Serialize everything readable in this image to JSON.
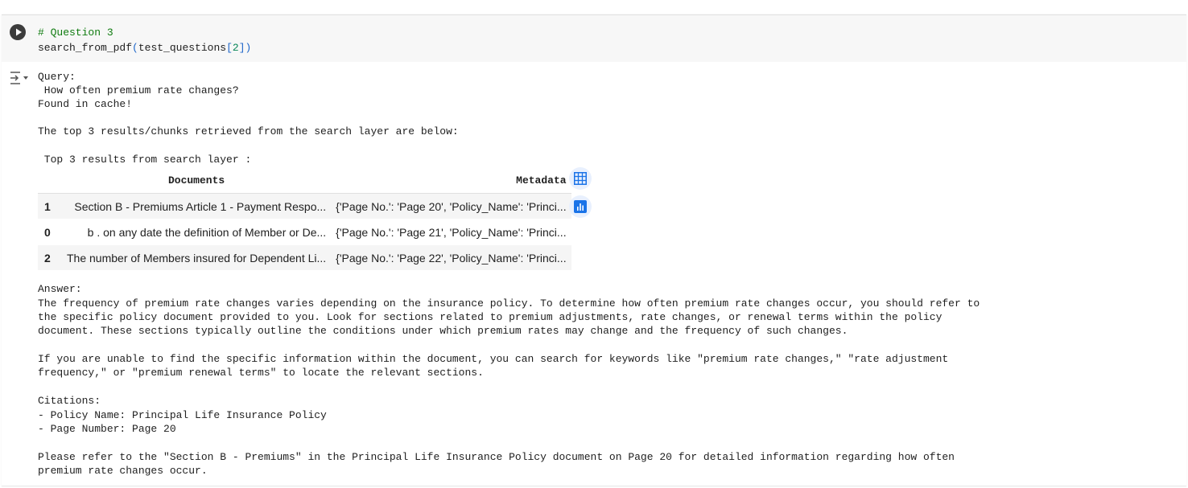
{
  "code_cell": {
    "comment": "# Question 3",
    "func": "search_from_pdf",
    "open_paren": "(",
    "arg_name": "test_questions",
    "open_bracket": "[",
    "index": "2",
    "close": "])"
  },
  "output": {
    "query_label": "Query:",
    "query_text": " How often premium rate changes?",
    "cache_text": "Found in cache!",
    "intro_text": "The top 3 results/chunks retrieved from the search layer are below:",
    "table_title": " Top 3 results from search layer :",
    "table": {
      "columns": [
        "Documents",
        "Metadata"
      ],
      "rows": [
        {
          "index": "1",
          "document": "Section B - Premiums Article 1 - Payment Respo...",
          "metadata": "{'Page No.': 'Page 20', 'Policy_Name': 'Princi..."
        },
        {
          "index": "0",
          "document": "b . on any date the definition of Member or De...",
          "metadata": "{'Page No.': 'Page 21', 'Policy_Name': 'Princi..."
        },
        {
          "index": "2",
          "document": "The number of Members insured for Dependent Li...",
          "metadata": "{'Page No.': 'Page 22', 'Policy_Name': 'Princi..."
        }
      ]
    },
    "answer_label": "Answer:",
    "answer_p1_l1": "The frequency of premium rate changes varies depending on the insurance policy. To determine how often premium rate changes occur, you should refer to",
    "answer_p1_l2": "the specific policy document provided to you. Look for sections related to premium adjustments, rate changes, or renewal terms within the policy",
    "answer_p1_l3": "document. These sections typically outline the conditions under which premium rates may change and the frequency of such changes.",
    "answer_p2_l1": "If you are unable to find the specific information within the document, you can search for keywords like \"premium rate changes,\" \"rate adjustment",
    "answer_p2_l2": "frequency,\" or \"premium renewal terms\" to locate the relevant sections.",
    "citations_label": "Citations:",
    "citation_1": "- Policy Name: Principal Life Insurance Policy",
    "citation_2": "- Page Number: Page 20",
    "closing_l1": "Please refer to the \"Section B - Premiums\" in the Principal Life Insurance Policy document on Page 20 for detailed information regarding how often",
    "closing_l2": "premium rate changes occur."
  },
  "icons": {
    "run": "play-circle-icon",
    "output_toggle": "output-collapse-icon",
    "table_view": "table-grid-icon",
    "chart_suggest": "bar-chart-icon"
  },
  "colors": {
    "comment": "#0f7b0f",
    "bracket": "#1e66c9",
    "number": "#098658",
    "accent": "#1a73e8"
  }
}
